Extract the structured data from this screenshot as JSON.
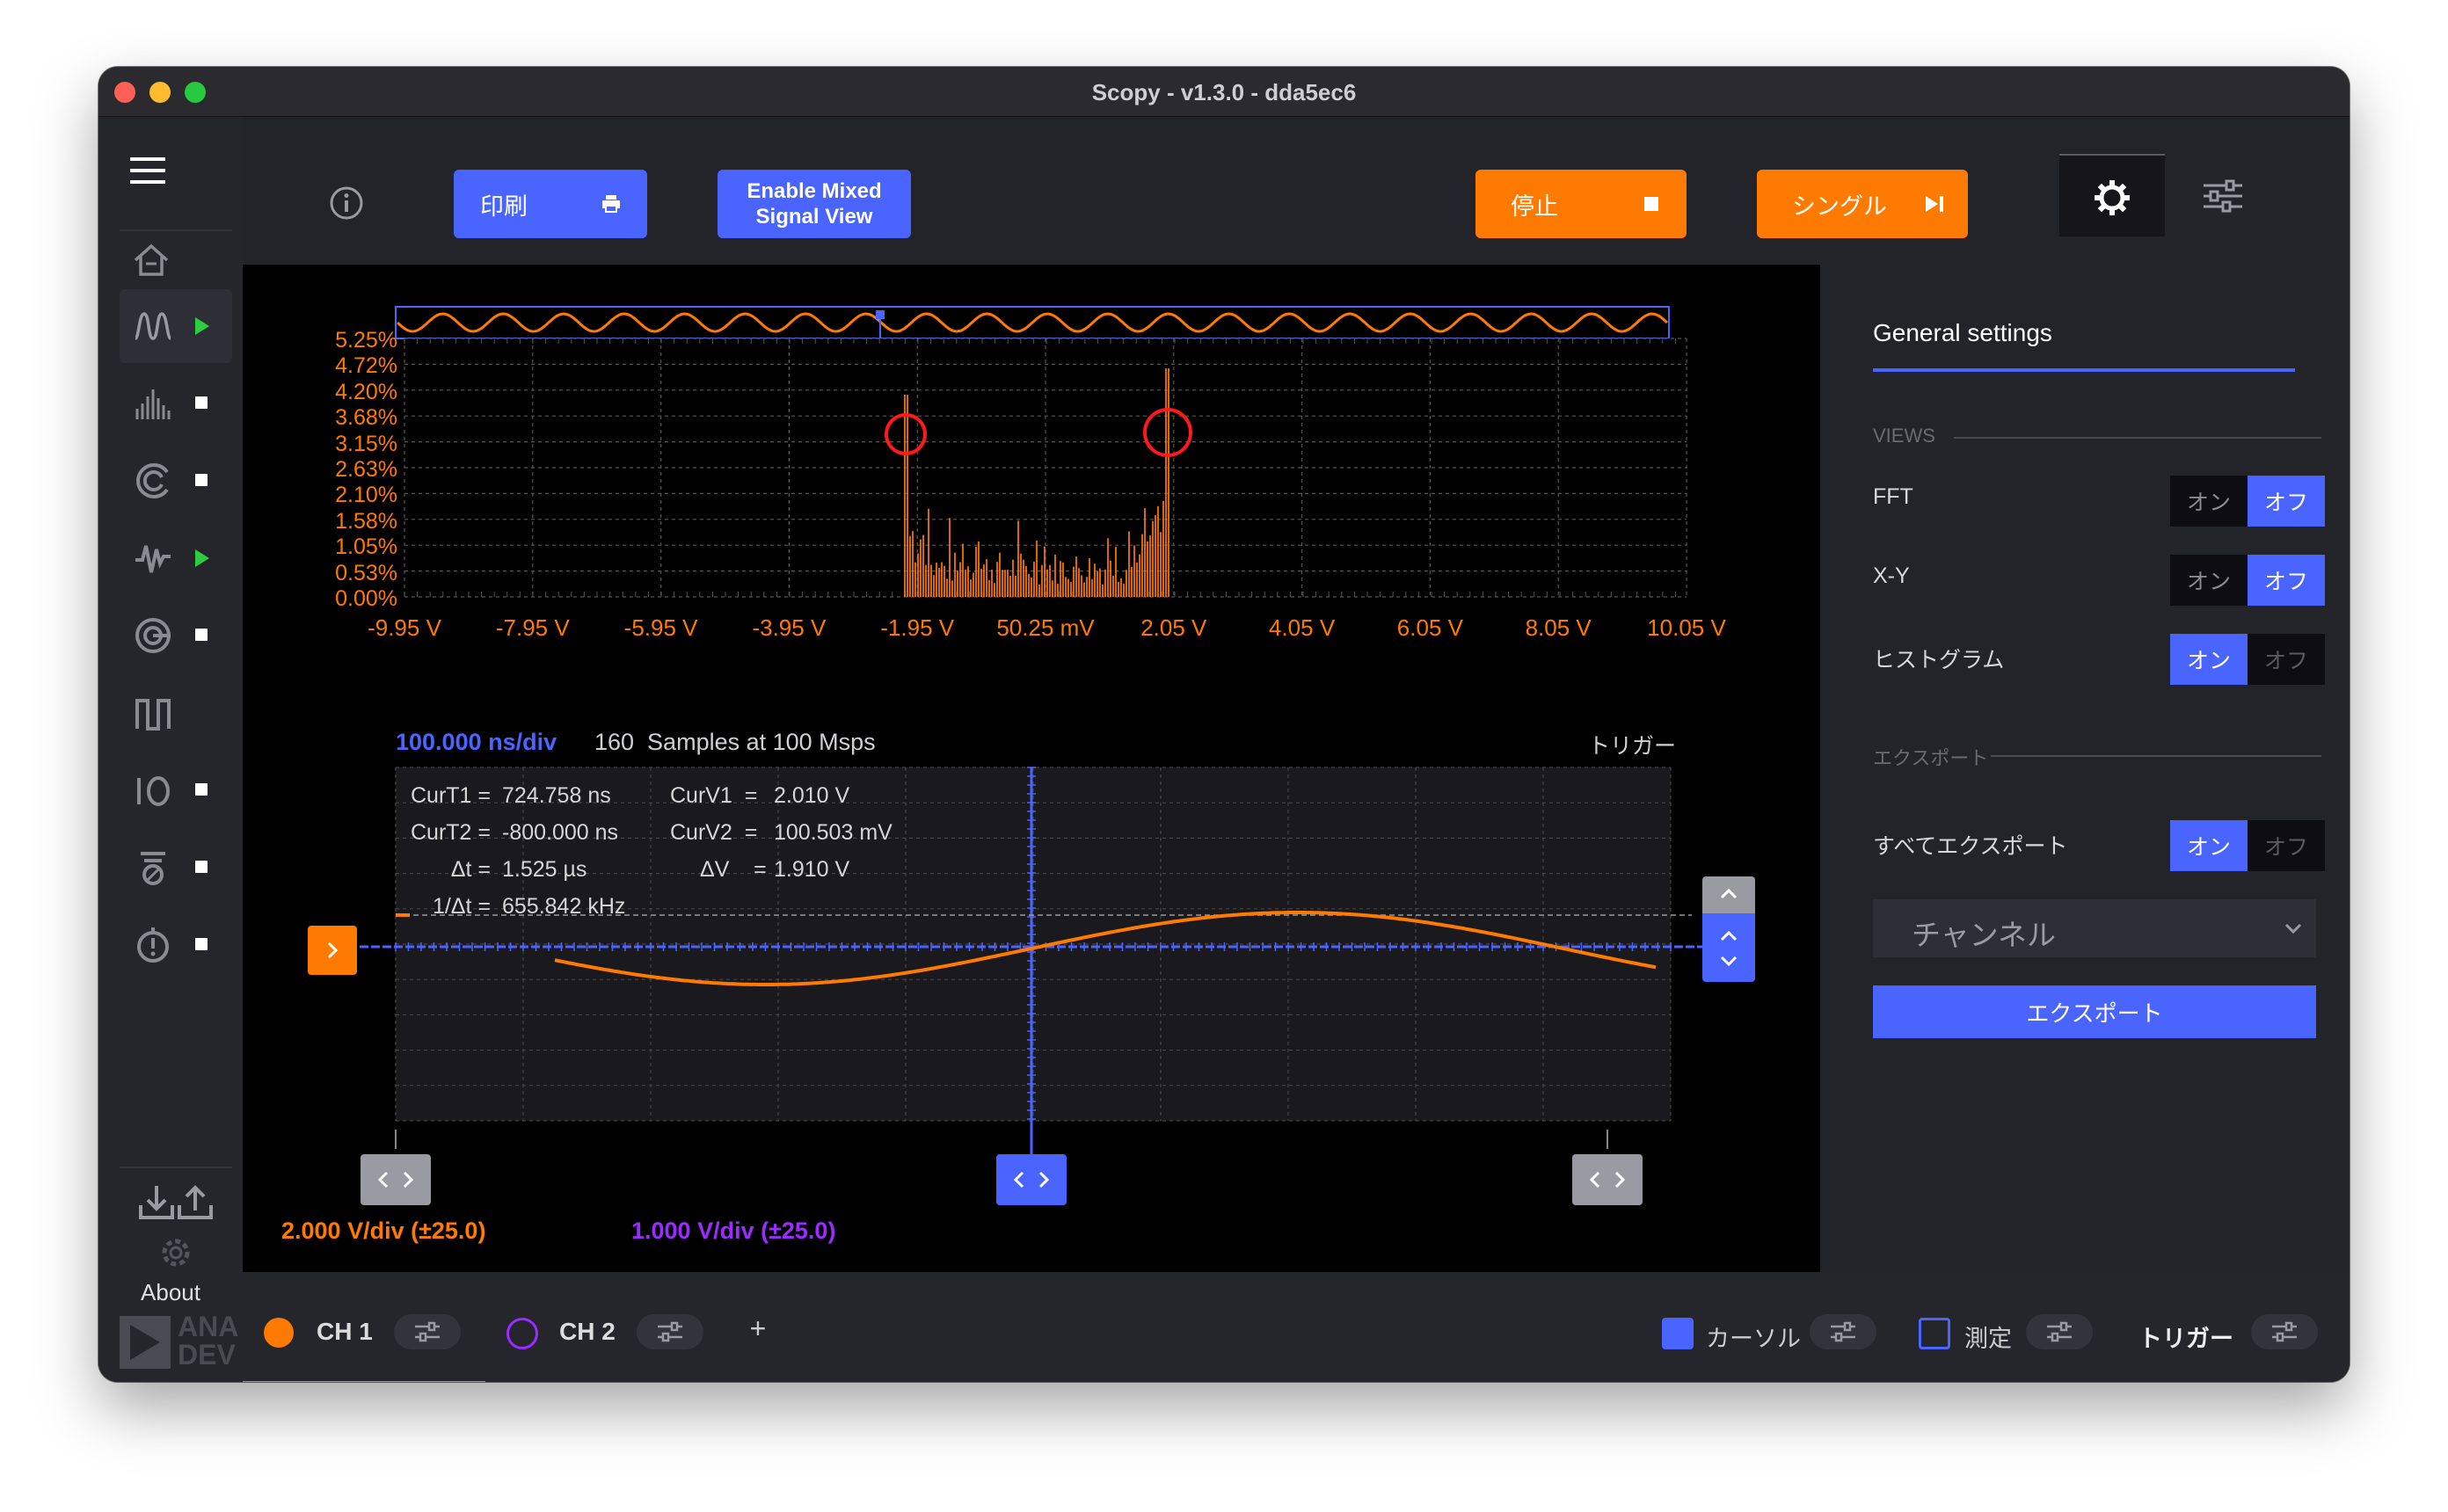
{
  "window": {
    "title": "Scopy - v1.3.0 - dda5ec6"
  },
  "sidebar": {
    "about_label": "About",
    "logo_text_1": "ANA",
    "logo_text_2": "DEV"
  },
  "toolbar": {
    "print_label": "印刷",
    "mixed_signal_line1": "Enable Mixed",
    "mixed_signal_line2": "Signal View",
    "stop_label": "停止",
    "single_label": "シングル"
  },
  "colors": {
    "accent_blue": "#4a64ff",
    "orange": "#ff7a00",
    "purple": "#9b2cff",
    "green": "#2ecc40"
  },
  "histogram": {
    "y_ticks": [
      "5.25%",
      "4.72%",
      "4.20%",
      "3.68%",
      "3.15%",
      "2.63%",
      "2.10%",
      "1.58%",
      "1.05%",
      "0.53%",
      "0.00%"
    ],
    "x_ticks": [
      "-9.95 V",
      "-7.95 V",
      "-5.95 V",
      "-3.95 V",
      "-1.95 V",
      "50.25 mV",
      "2.05 V",
      "4.05 V",
      "6.05 V",
      "8.05 V",
      "10.05 V"
    ]
  },
  "scope": {
    "timebase": "100.000 ns/div",
    "samples": "160  Samples at 100 Msps",
    "trigger_label": "トリガー",
    "cursors": {
      "curT1_label": "CurT1 =",
      "curT1_value": "724.758 ns",
      "curT2_label": "CurT2 =",
      "curT2_value": "-800.000 ns",
      "dt_label": "Δt =",
      "dt_value": "1.525 µs",
      "inv_dt_label": "1/Δt =",
      "inv_dt_value": "655.842 kHz",
      "curV1_label": "CurV1  =",
      "curV1_value": "2.010 V",
      "curV2_label": "CurV2  =",
      "curV2_value": "100.503 mV",
      "dv_label": "ΔV    =",
      "dv_value": "1.910 V"
    },
    "ch1_scale": "2.000 V/div (±25.0)",
    "ch2_scale": "1.000 V/div (±25.0)"
  },
  "settings": {
    "title": "General settings",
    "views_label": "VIEWS",
    "fft_label": "FFT",
    "xy_label": "X-Y",
    "histogram_label": "ヒストグラム",
    "on_label": "オン",
    "off_label": "オフ",
    "export_section_label": "エクスポート",
    "export_all_label": "すべてエクスポート",
    "channel_select_value": "チャンネル",
    "export_button_label": "エクスポート"
  },
  "bottom": {
    "ch1_label": "CH 1",
    "ch2_label": "CH 2",
    "add_label": "+",
    "cursor_label": "カーソル",
    "measure_label": "測定",
    "trigger_label": "トリガー"
  }
}
